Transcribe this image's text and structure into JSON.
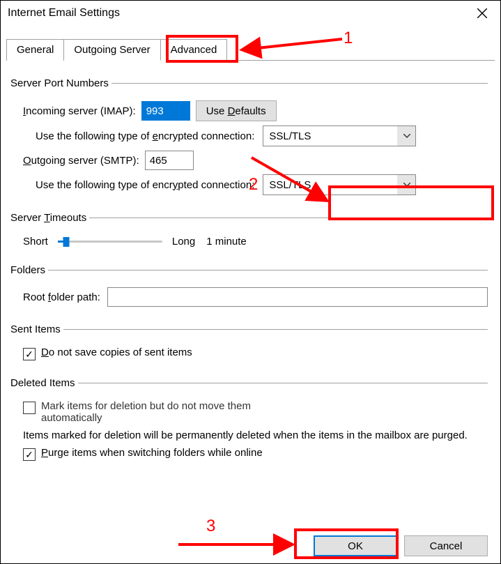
{
  "window": {
    "title": "Internet Email Settings"
  },
  "tabs": {
    "general": "General",
    "outgoing": "Outgoing Server",
    "advanced": "Advanced"
  },
  "spn": {
    "legend": "Server Port Numbers",
    "incoming_label_pre": "Incoming server (IMAP):",
    "incoming_value": "993",
    "use_defaults": "Use Defaults",
    "enc_label": "Use the following type of encrypted connection:",
    "incoming_enc_value": "SSL/TLS",
    "outgoing_label_pre": "Outgoing server (SMTP):",
    "outgoing_value": "465",
    "outgoing_enc_value": "SSL/TLS"
  },
  "timeouts": {
    "legend": "Server Timeouts",
    "short": "Short",
    "long": "Long",
    "value_label": "1 minute"
  },
  "folders": {
    "legend": "Folders",
    "root_label": "Root folder path:",
    "root_value": ""
  },
  "sent": {
    "legend": "Sent Items",
    "dont_save": "Do not save copies of sent items"
  },
  "deleted": {
    "legend": "Deleted Items",
    "mark_line1": "Mark items for deletion but do not move them",
    "mark_line2": "automatically",
    "note": "Items marked for deletion will be permanently deleted when the items in the mailbox are purged.",
    "purge": "Purge items when switching folders while online"
  },
  "buttons": {
    "ok": "OK",
    "cancel": "Cancel"
  },
  "annotations": {
    "n1": "1",
    "n2": "2",
    "n3": "3"
  }
}
